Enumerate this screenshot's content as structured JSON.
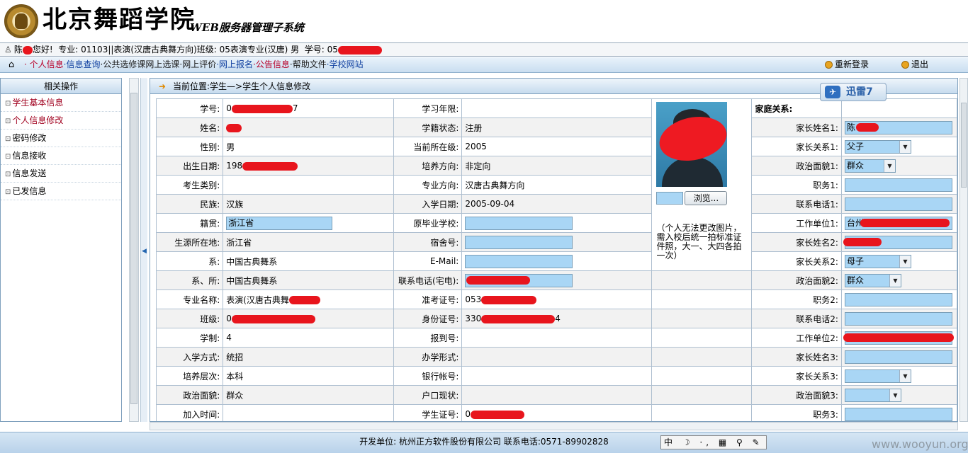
{
  "header": {
    "school_name": "北京舞蹈学院",
    "system_name": "WEB服务器管理子系统"
  },
  "userbar": {
    "greet_prefix": "陈",
    "greet_suffix": "您好!",
    "info": "专业: 01103||表演(汉唐古典舞方向)班级: 05表演专业(汉唐) 男",
    "student_no_label": "学号: 05"
  },
  "nav": {
    "home_icon": "home-icon",
    "links": [
      "个人信息",
      "信息查询",
      "公共选修课",
      "网上选课",
      "网上评价",
      "网上报名",
      "公告信息",
      "帮助文件",
      "学校网站"
    ],
    "relogin": "重新登录",
    "logout": "退出"
  },
  "sidebar": {
    "title": "相关操作",
    "items": [
      "学生基本信息",
      "个人信息修改",
      "密码修改",
      "信息接收",
      "信息发送",
      "已发信息"
    ]
  },
  "main": {
    "breadcrumb": "当前位置:学生—>学生个人信息修改",
    "thunder": "迅雷7",
    "photo_browse": "浏览...",
    "photo_note": "（个人无法更改图片，需入校后统一拍标准证件照，大一、大四各拍一次）",
    "family_head": "家庭关系:"
  },
  "rows": [
    {
      "l1": "学号:",
      "v1": "0",
      "v1_tail": "7",
      "l2": "学习年限:",
      "v2": "",
      "l3": "家庭关系:",
      "v3": ""
    },
    {
      "l1": "姓名:",
      "v1": "",
      "l2": "学籍状态:",
      "v2": "注册",
      "l3": "家长姓名1:",
      "v3": "陈"
    },
    {
      "l1": "性别:",
      "v1": "男",
      "l2": "当前所在级:",
      "v2": "2005",
      "l3": "家长关系1:",
      "v3": "父子"
    },
    {
      "l1": "出生日期:",
      "v1": "198",
      "l2": "培养方向:",
      "v2": "非定向",
      "l3": "政治面貌1:",
      "v3": "群众"
    },
    {
      "l1": "考生类别:",
      "v1": "",
      "l2": "专业方向:",
      "v2": "汉唐古典舞方向",
      "l3": "职务1:",
      "v3": ""
    },
    {
      "l1": "民族:",
      "v1": "汉族",
      "l2": "入学日期:",
      "v2": "2005-09-04",
      "l3": "联系电话1:",
      "v3": ""
    },
    {
      "l1": "籍贯:",
      "v1": "浙江省",
      "l2": "原毕业学校:",
      "v2": "",
      "l3": "工作单位1:",
      "v3": "台州"
    },
    {
      "l1": "生源所在地:",
      "v1": "浙江省",
      "l2": "宿舍号:",
      "v2": "",
      "l3": "家长姓名2:",
      "v3": ""
    },
    {
      "l1": "系:",
      "v1": "中国古典舞系",
      "l2": "E-Mail:",
      "v2": "",
      "l3": "家长关系2:",
      "v3": "母子"
    },
    {
      "l1": "系、所:",
      "v1": "中国古典舞系",
      "l2": "联系电话(宅电):",
      "v2": "",
      "l3": "政治面貌2:",
      "v3": "群众"
    },
    {
      "l1": "专业名称:",
      "v1": "表演(汉唐古典舞",
      "l2": "准考证号:",
      "v2": "053",
      "l3": "职务2:",
      "v3": ""
    },
    {
      "l1": "班级:",
      "v1": "0",
      "l2": "身份证号:",
      "v2": "330",
      "v2_tail": "4",
      "l3": "联系电话2:",
      "v3": ""
    },
    {
      "l1": "学制:",
      "v1": "4",
      "l2": "报到号:",
      "v2": "",
      "l3": "工作单位2:",
      "v3": ""
    },
    {
      "l1": "入学方式:",
      "v1": "统招",
      "l2": "办学形式:",
      "v2": "",
      "l3": "家长姓名3:",
      "v3": ""
    },
    {
      "l1": "培养层次:",
      "v1": "本科",
      "l2": "银行帐号:",
      "v2": "",
      "l3": "家长关系3:",
      "v3": ""
    },
    {
      "l1": "政治面貌:",
      "v1": "群众",
      "l2": "户口现状:",
      "v2": "",
      "l3": "政治面貌3:",
      "v3": ""
    },
    {
      "l1": "加入时间:",
      "v1": "",
      "l2": "学生证号:",
      "v2": "0",
      "l3": "职务3:",
      "v3": ""
    }
  ],
  "footer": {
    "text": "开发单位: 杭州正方软件股份有限公司 联系电话:0571-89902828",
    "ime": "中 ☽ ·, ▦ ⚲ ✎",
    "watermark": "www.wooyun.org"
  }
}
